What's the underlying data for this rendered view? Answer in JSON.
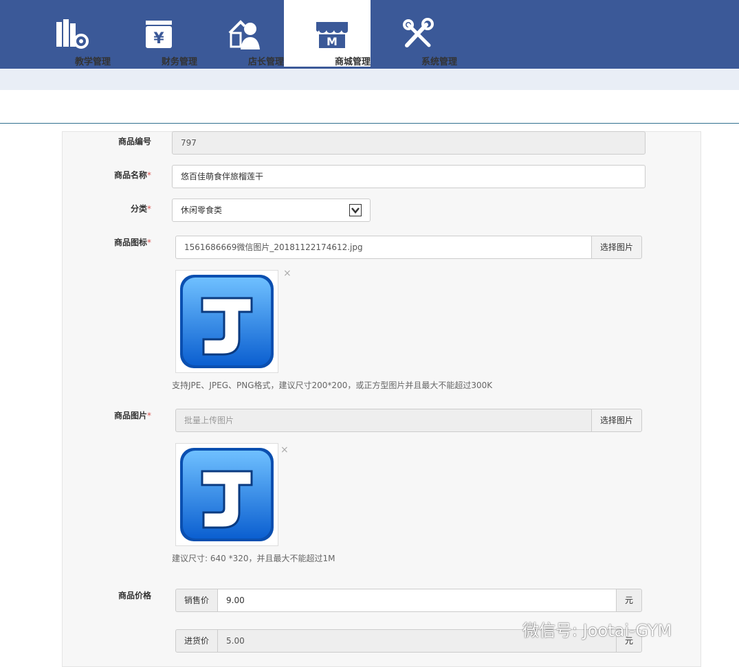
{
  "nav": {
    "items": [
      {
        "label": "教学管理",
        "icon": "books-gear-icon"
      },
      {
        "label": "财务管理",
        "icon": "yen-wallet-icon"
      },
      {
        "label": "店长管理",
        "icon": "manager-icon"
      },
      {
        "label": "商城管理",
        "icon": "store-icon"
      },
      {
        "label": "系统管理",
        "icon": "tools-icon"
      }
    ],
    "active_index": 3
  },
  "colors": {
    "nav_bg": "#3b5998",
    "required": "#d9534f",
    "logo_blue": "#1a6fd6"
  },
  "form": {
    "product_id": {
      "label": "商品编号",
      "value": "797"
    },
    "product_name": {
      "label": "商品名称",
      "required": "*",
      "value": "悠百佳萌食伴旅榴莲干"
    },
    "category": {
      "label": "分类",
      "required": "*",
      "value": "休闲零食类"
    },
    "icon": {
      "label": "商品图标",
      "required": "*",
      "value": "1561686669微信图片_20181122174612.jpg",
      "button": "选择图片",
      "remove": "×",
      "hint": "支持JPE、JPEG、PNG格式，建议尺寸200*200，或正方型图片并且最大不能超过300K"
    },
    "images": {
      "label": "商品图片",
      "required": "*",
      "placeholder": "批量上传图片",
      "button": "选择图片",
      "remove": "×",
      "hint": "建议尺寸: 640 *320，并且最大不能超过1M"
    },
    "price": {
      "label": "商品价格",
      "sale_label": "销售价",
      "sale_value": "9.00",
      "unit": "元",
      "cost_label": "进货价",
      "cost_value": "5.00",
      "cost_unit": "元"
    }
  },
  "watermark": "微信号: Jootai-GYM"
}
